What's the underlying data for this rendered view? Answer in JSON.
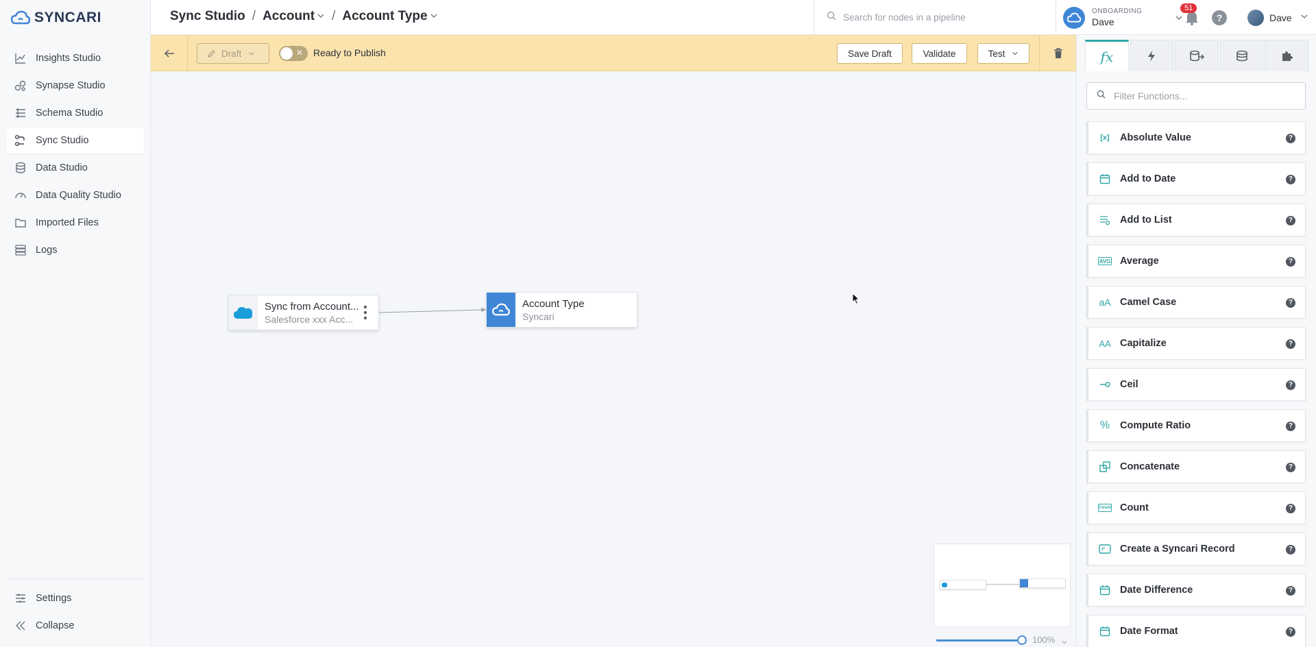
{
  "brand": {
    "name": "SYNCARI",
    "accent": "#3f86d6",
    "teal": "#2fa6a5"
  },
  "sidebar": {
    "items": [
      {
        "label": "Insights Studio",
        "icon": "chart-icon",
        "active": false
      },
      {
        "label": "Synapse Studio",
        "icon": "synapse-icon",
        "active": false
      },
      {
        "label": "Schema Studio",
        "icon": "schema-icon",
        "active": false
      },
      {
        "label": "Sync Studio",
        "icon": "sync-icon",
        "active": true
      },
      {
        "label": "Data Studio",
        "icon": "database-icon",
        "active": false
      },
      {
        "label": "Data Quality Studio",
        "icon": "gauge-icon",
        "active": false
      },
      {
        "label": "Imported Files",
        "icon": "folder-icon",
        "active": false
      },
      {
        "label": "Logs",
        "icon": "logs-icon",
        "active": false
      }
    ],
    "settings_label": "Settings",
    "collapse_label": "Collapse"
  },
  "header": {
    "breadcrumb": [
      "Sync Studio",
      "Account",
      "Account Type"
    ],
    "search_placeholder": "Search for nodes in a pipeline",
    "org_label": "ONBOARDING",
    "org_user": "Dave",
    "notifications": "51",
    "user_name": "Dave"
  },
  "toolbar": {
    "draft_label": "Draft",
    "publish_label": "Ready to Publish",
    "save_draft": "Save Draft",
    "validate": "Validate",
    "test": "Test"
  },
  "canvas": {
    "nodes": [
      {
        "title": "Sync from Account...",
        "subtitle": "Salesforce xxx Acc...",
        "icon": "salesforce-icon"
      },
      {
        "title": "Account Type",
        "subtitle": "Syncari",
        "icon": "syncari-cloud-icon"
      }
    ],
    "zoom_percent": "100%",
    "zoom_level": 1.0
  },
  "panel": {
    "filter_placeholder": "Filter Functions...",
    "functions": [
      {
        "label": "Absolute Value",
        "icon": "[x]"
      },
      {
        "label": "Add to Date",
        "icon": "calendar-icon"
      },
      {
        "label": "Add to List",
        "icon": "list-icon"
      },
      {
        "label": "Average",
        "icon": "AVG"
      },
      {
        "label": "Camel Case",
        "icon": "aA"
      },
      {
        "label": "Capitalize",
        "icon": "AA"
      },
      {
        "label": "Ceil",
        "icon": "ceil-icon"
      },
      {
        "label": "Compute Ratio",
        "icon": "%"
      },
      {
        "label": "Concatenate",
        "icon": "concat-icon"
      },
      {
        "label": "Count",
        "icon": "count-icon"
      },
      {
        "label": "Create a Syncari Record",
        "icon": "record-icon"
      },
      {
        "label": "Date Difference",
        "icon": "calendar-icon"
      },
      {
        "label": "Date Format",
        "icon": "calendar-icon"
      }
    ]
  }
}
